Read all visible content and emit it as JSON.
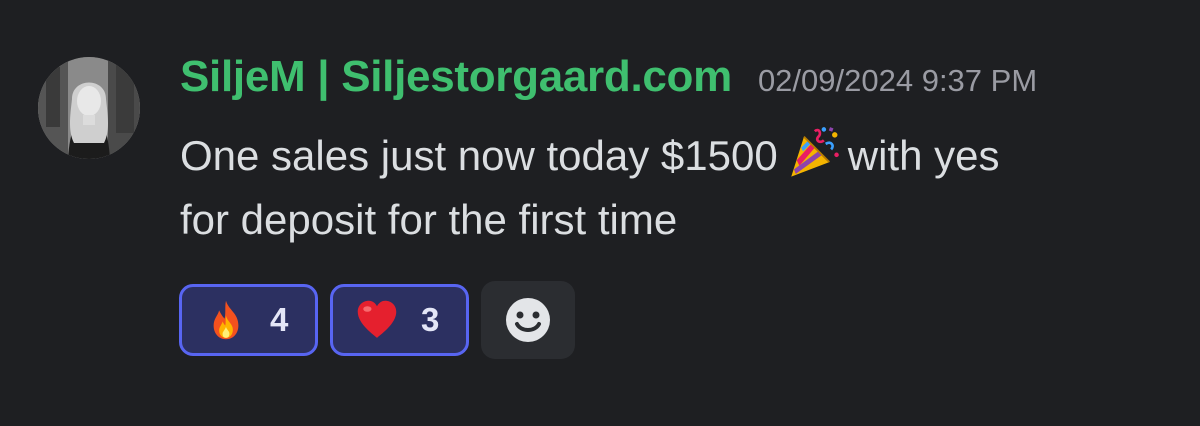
{
  "message": {
    "author": "SiljeM | Siljestorgaard.com",
    "timestamp": "02/09/2024 9:37 PM",
    "text_line1_before_emoji": "One sales just now today $1500",
    "text_line1_after_emoji": "with yes",
    "text_line2": "for deposit for the first time",
    "inline_emoji": "party-popper-icon"
  },
  "reactions": [
    {
      "emoji": "fire-icon",
      "count": "4",
      "selected": true
    },
    {
      "emoji": "heart-icon",
      "count": "3",
      "selected": true
    }
  ],
  "add_reaction": {
    "icon": "smiley-icon"
  },
  "colors": {
    "background": "#1e1f22",
    "username": "#3fbf6f",
    "timestamp": "#9a9ba3",
    "text": "#dbdee1",
    "reaction_border": "#5865f2",
    "reaction_bg": "#2c3061"
  }
}
